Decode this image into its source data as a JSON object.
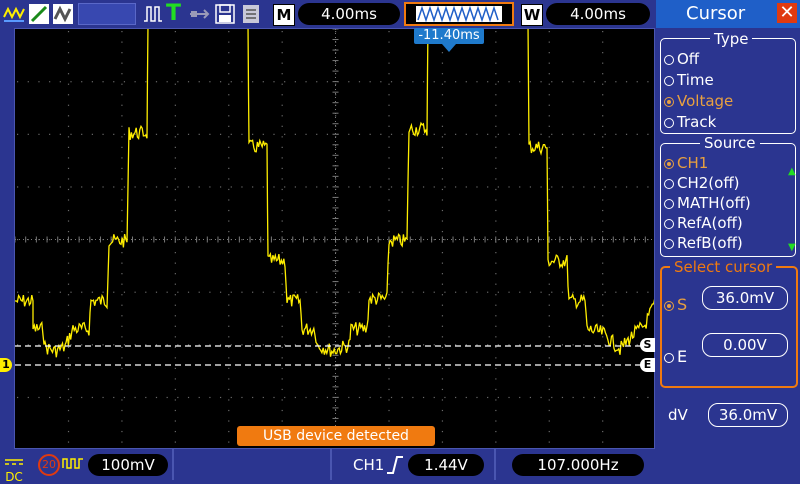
{
  "colors": {
    "trace": "#ffee00",
    "accent": "#f07a10",
    "panel": "#2b3590",
    "title": "#1f5fc8"
  },
  "header": {
    "m_label": "M",
    "timebase": "4.00ms",
    "w_label": "W",
    "window_timebase": "4.00ms",
    "trigger_position": "-11.40ms",
    "trigger_mode_icon": "T"
  },
  "panel": {
    "title": "Cursor",
    "close_icon": "close-icon",
    "type": {
      "title": "Type",
      "options": [
        {
          "label": "Off",
          "selected": false
        },
        {
          "label": "Time",
          "selected": false
        },
        {
          "label": "Voltage",
          "selected": true
        },
        {
          "label": "Track",
          "selected": false
        }
      ]
    },
    "source": {
      "title": "Source",
      "options": [
        {
          "label": "CH1",
          "selected": true
        },
        {
          "label": "CH2(off)",
          "selected": false
        },
        {
          "label": "MATH(off)",
          "selected": false
        },
        {
          "label": "RefA(off)",
          "selected": false
        },
        {
          "label": "RefB(off)",
          "selected": false
        }
      ]
    },
    "select_cursor": {
      "title": "Select cursor",
      "s_label": "S",
      "s_value": "36.0mV",
      "e_label": "E",
      "e_value": "0.00V"
    },
    "dv_label": "dV",
    "dv_value": "36.0mV"
  },
  "screen": {
    "usb_message": "USB device detected",
    "channel_marker": "1",
    "cursor_s_marker": "S",
    "cursor_e_marker": "E"
  },
  "footer": {
    "coupling": "DC",
    "bw_limit": "20",
    "volts_div": "100mV",
    "trigger_source": "CH1",
    "trigger_level": "1.44V",
    "frequency": "107.000Hz"
  }
}
